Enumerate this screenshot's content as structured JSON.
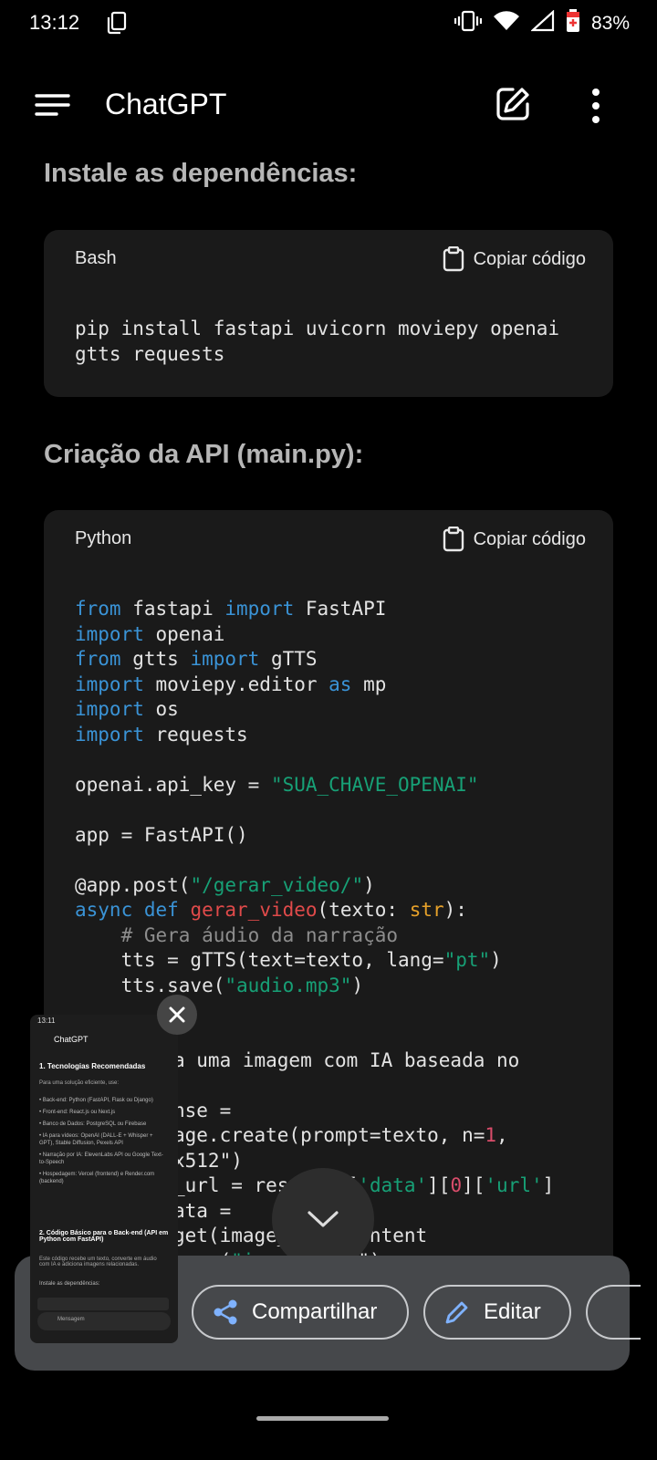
{
  "status": {
    "time": "13:12",
    "battery": "83%"
  },
  "appbar": {
    "title": "ChatGPT"
  },
  "section1": {
    "heading": "Instale as dependências:",
    "lang": "Bash",
    "copy": "Copiar código",
    "code": [
      "pip install fastapi uvicorn moviepy openai",
      "gtts requests"
    ]
  },
  "section2": {
    "heading": "Criação da API (main.py):",
    "lang": "Python",
    "copy": "Copiar código",
    "code": [
      "from fastapi import FastAPI",
      "import openai",
      "from gtts import gTTS",
      "import moviepy.editor as mp",
      "import os",
      "import requests",
      "",
      "openai.api_key = \"SUA_CHAVE_OPENAI\"",
      "",
      "app = FastAPI()",
      "",
      "@app.post(\"/gerar_video/\")",
      "async def gerar_video(texto: str):",
      "    # Gera áudio da narração",
      "    tts = gTTS(text=texto, lang=\"pt\")",
      "    tts.save(\"audio.mp3\")",
      "",
      "a uma imagem com IA baseada no",
      "",
      "nse =",
      "age.create(prompt=texto, n=1,",
      "x512\")",
      "_url = response['data'][0]['url']",
      "ata =",
      "get(image_url).content",
      "open(\"ima  , \"wb\") as"
    ]
  },
  "share": {
    "share_label": "Compartilhar",
    "edit_label": "Editar"
  },
  "thumbnail": {
    "time": "13:11",
    "title": "ChatGPT",
    "heading": "1. Tecnologias Recomendadas",
    "intro": "Para uma solução eficiente, use:",
    "bullets": [
      "Back-end: Python (FastAPI, Flask ou Django)",
      "Front-end: React.js ou Next.js",
      "Banco de Dados: PostgreSQL ou Firebase",
      "IA para vídeos: OpenAI (DALL-E + Whisper + GPT), Stable Diffusion, Pexels API",
      "Narração por IA: ElevenLabs API ou Google Text-to-Speech",
      "Hospedagem: Vercel (frontend) e Render.com (backend)"
    ],
    "heading2": "2. Código Básico para o Back-end (API em Python com FastAPI)",
    "para": "Este código recebe um texto, converte em áudio com IA e adiciona imagens relacionadas.",
    "install": "Instale as dependências:",
    "lang": "Bash",
    "copy": "Copiar código",
    "placeholder": "Mensagem"
  }
}
